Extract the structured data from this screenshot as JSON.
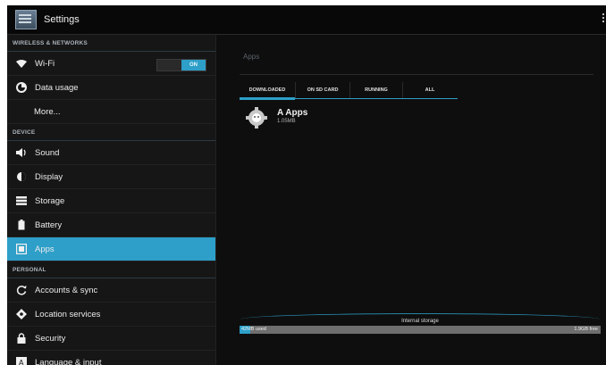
{
  "actionbar": {
    "title": "Settings"
  },
  "sidebar": {
    "sections": {
      "wireless": "WIRELESS & NETWORKS",
      "device": "DEVICE",
      "personal": "PERSONAL"
    },
    "items": [
      {
        "label": "Wi-Fi",
        "icon": "wifi-icon"
      },
      {
        "label": "Data usage",
        "icon": "data-usage-icon"
      },
      {
        "label": "More...",
        "icon": ""
      },
      {
        "label": "Sound",
        "icon": "sound-icon"
      },
      {
        "label": "Display",
        "icon": "display-icon"
      },
      {
        "label": "Storage",
        "icon": "storage-icon"
      },
      {
        "label": "Battery",
        "icon": "battery-icon"
      },
      {
        "label": "Apps",
        "icon": "apps-icon"
      },
      {
        "label": "Accounts & sync",
        "icon": "sync-icon"
      },
      {
        "label": "Location services",
        "icon": "location-icon"
      },
      {
        "label": "Security",
        "icon": "lock-icon"
      },
      {
        "label": "Language & input",
        "icon": "language-icon"
      }
    ],
    "wifi_toggle": "ON",
    "selected": "Apps"
  },
  "main": {
    "title": "Apps",
    "tabs": [
      "DOWNLOADED",
      "ON SD CARD",
      "RUNNING",
      "ALL"
    ],
    "selected_tab": "DOWNLOADED",
    "apps": [
      {
        "name": "A Apps",
        "size": "1.05MB"
      }
    ],
    "storage": {
      "label": "Internal storage",
      "used": "42MB used",
      "free": "1.9GB free"
    }
  },
  "colors": {
    "accent": "#2d9fc9",
    "background": "#0c0c0c",
    "sidebar": "#161616"
  }
}
